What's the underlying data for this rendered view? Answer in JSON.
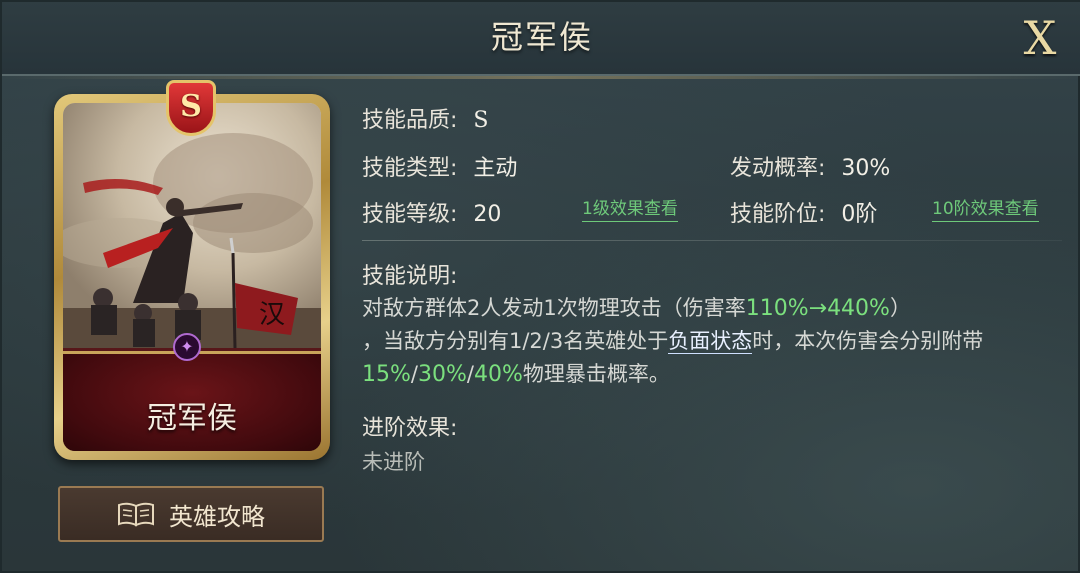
{
  "header": {
    "title": "冠军侯",
    "close_label": "X"
  },
  "card": {
    "crest_letter": "S",
    "name": "冠军侯",
    "banner_char": "汉"
  },
  "guide_button": {
    "label": "英雄攻略",
    "icon": "book-icon"
  },
  "skill": {
    "quality_label": "技能品质:",
    "quality_value": "S",
    "type_label": "技能类型:",
    "type_value": "主动",
    "trigger_label": "发动概率:",
    "trigger_value": "30%",
    "level_label": "技能等级:",
    "level_value": "20",
    "level1_link": "1级效果查看",
    "tier_label": "技能阶位:",
    "tier_value": "0阶",
    "tier10_link": "10阶效果查看",
    "desc_label": "技能说明:",
    "desc": {
      "p1": "对敌方群体2人发动1次物理攻击（伤害率",
      "p1_hl": "110%→440%",
      "p1_end": "）",
      "p2": "，当敌方分别有1/2/3名英雄处于",
      "status_link": "负面状态",
      "p3": "时，本次伤害会分别附带",
      "hl2": "15%",
      "sep1": "/",
      "hl3": "30%",
      "sep2": "/",
      "hl4": "40%",
      "p4": "物理暴击概率。"
    },
    "advance_label": "进阶效果:",
    "advance_value": "未进阶"
  },
  "colors": {
    "highlight": "#7be07e",
    "gold": "#e4c46a",
    "panel": "#2d3a3d"
  }
}
